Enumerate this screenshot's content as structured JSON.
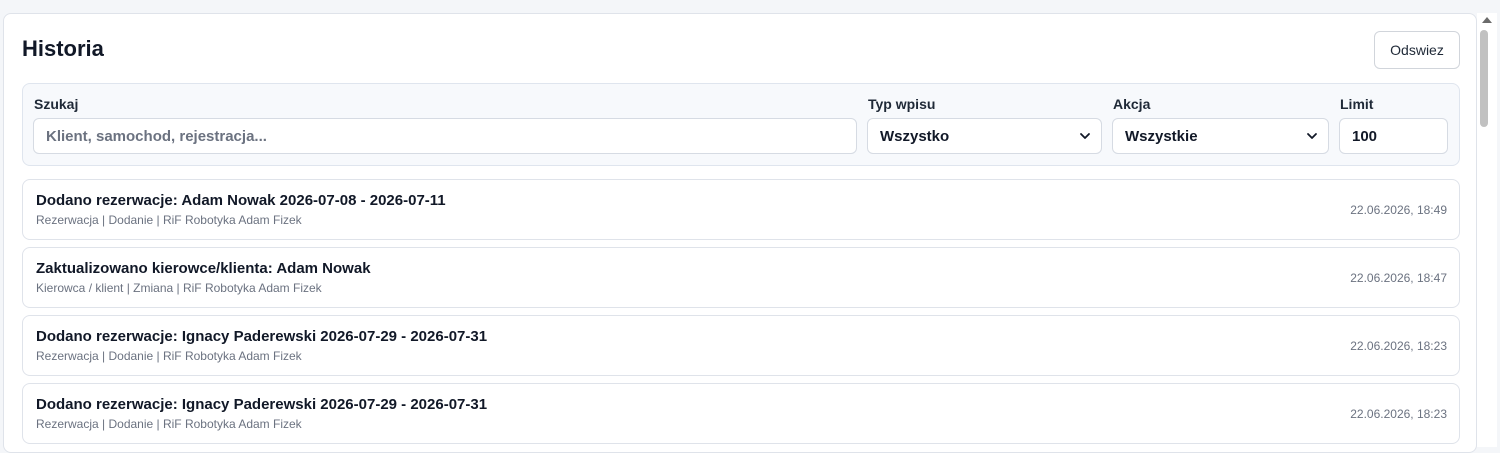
{
  "header": {
    "title": "Historia",
    "refresh_label": "Odswiez"
  },
  "filters": {
    "search": {
      "label": "Szukaj",
      "placeholder": "Klient, samochod, rejestracja..."
    },
    "type": {
      "label": "Typ wpisu",
      "value": "Wszystko"
    },
    "action": {
      "label": "Akcja",
      "value": "Wszystkie"
    },
    "limit": {
      "label": "Limit",
      "value": "100"
    }
  },
  "entries": [
    {
      "title": "Dodano rezerwacje: Adam Nowak 2026-07-08 - 2026-07-11",
      "meta": "Rezerwacja | Dodanie | RiF Robotyka Adam Fizek",
      "time": "22.06.2026, 18:49"
    },
    {
      "title": "Zaktualizowano kierowce/klienta: Adam Nowak",
      "meta": "Kierowca / klient | Zmiana | RiF Robotyka Adam Fizek",
      "time": "22.06.2026, 18:47"
    },
    {
      "title": "Dodano rezerwacje: Ignacy Paderewski 2026-07-29 - 2026-07-31",
      "meta": "Rezerwacja | Dodanie | RiF Robotyka Adam Fizek",
      "time": "22.06.2026, 18:23"
    },
    {
      "title": "Dodano rezerwacje: Ignacy Paderewski 2026-07-29 - 2026-07-31",
      "meta": "Rezerwacja | Dodanie | RiF Robotyka Adam Fizek",
      "time": "22.06.2026, 18:23"
    }
  ],
  "icons": {
    "select_chevron": "chevron-down-icon",
    "scroll_up": "scroll-up-arrow-icon"
  },
  "colors": {
    "background": "#f4f6f9",
    "card": "#ffffff",
    "border": "#dfe3ea",
    "text_primary": "#111827",
    "text_muted": "#6b7280"
  }
}
